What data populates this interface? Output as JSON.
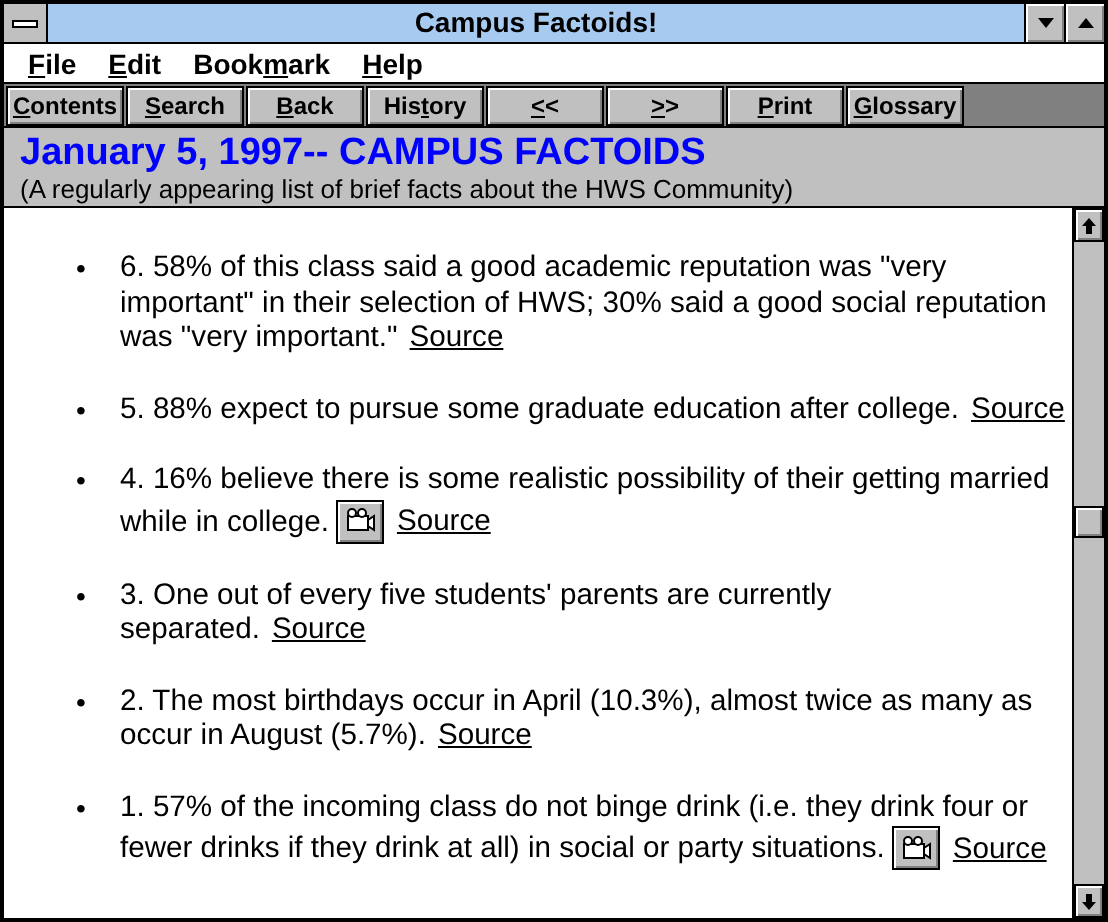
{
  "window": {
    "title": "Campus Factoids!"
  },
  "menu": [
    {
      "key": "F",
      "after": "ile"
    },
    {
      "key": "E",
      "after": "dit"
    },
    {
      "before": "Book",
      "key": "m",
      "after": "ark"
    },
    {
      "key": "H",
      "after": "elp"
    }
  ],
  "toolbar": [
    {
      "key": "C",
      "after": "ontents"
    },
    {
      "key": "S",
      "after": "earch"
    },
    {
      "key": "B",
      "after": "ack"
    },
    {
      "before": "His",
      "key": "t",
      "after": "ory"
    },
    {
      "key": "<",
      "after": "<"
    },
    {
      "key": ">",
      "after": ">"
    },
    {
      "key": "P",
      "after": "rint"
    },
    {
      "key": "G",
      "after": "lossary"
    }
  ],
  "header": {
    "title": "January 5, 1997-- CAMPUS FACTOIDS",
    "subtitle": "(A regularly appearing list of brief facts about the HWS Community)"
  },
  "facts": [
    {
      "bullet": "•",
      "text": "6.  58% of this class said a good academic reputation was \"very important\" in their selection of HWS;  30% said a good social reputation was \"very important.\"",
      "media": false,
      "link": "Source"
    },
    {
      "bullet": "•",
      "text": "5.  88% expect to pursue some graduate education after college.",
      "media": false,
      "link": "Source"
    },
    {
      "bullet": "•",
      "text": "4.  16% believe there is some realistic possibility of their getting married while in college.",
      "media": true,
      "link": "Source"
    },
    {
      "bullet": "•",
      "text": "3.  One out of every five students' parents are currently separated.",
      "media": false,
      "link": "Source"
    },
    {
      "bullet": "•",
      "text": "2.  The most birthdays occur in April (10.3%), almost twice as many as occur in August (5.7%).",
      "media": false,
      "link": "Source"
    },
    {
      "bullet": "•",
      "text": "1.  57% of the incoming class do not binge drink (i.e. they drink four or fewer drinks if they drink at all) in social or party situations.",
      "media": true,
      "link": "Source"
    }
  ]
}
